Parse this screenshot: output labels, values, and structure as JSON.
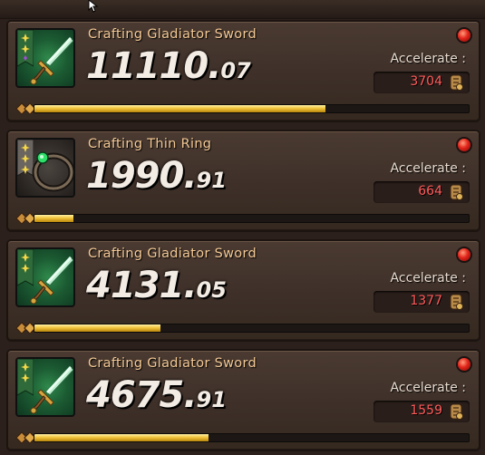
{
  "colors": {
    "title_text": "#f3c995",
    "timer_text": "#f3ece4",
    "accelerate_value": "#ff5b5b",
    "progress_fill": "#f2c43c",
    "alert_dot": "#e2241a",
    "panel_bg": "#3e3029"
  },
  "cursor_icon": "mouse-pointer-icon",
  "queue": [
    {
      "title": "Crafting Gladiator Sword",
      "timer_main": "11110.",
      "timer_frac": "07",
      "accelerate_label": "Accelerate :",
      "accelerate_value": "3704",
      "progress": 0.67,
      "item": "gladiator-sword",
      "rank_stars": 3,
      "rarity_gem": "purple",
      "slot_color": "green"
    },
    {
      "title": "Crafting Thin Ring",
      "timer_main": "1990.",
      "timer_frac": "91",
      "accelerate_label": "Accelerate :",
      "accelerate_value": "664",
      "progress": 0.09,
      "item": "thin-ring",
      "rank_stars": 3,
      "rarity_gem": "",
      "slot_color": "gray"
    },
    {
      "title": "Crafting Gladiator Sword",
      "timer_main": "4131.",
      "timer_frac": "05",
      "accelerate_label": "Accelerate :",
      "accelerate_value": "1377",
      "progress": 0.29,
      "item": "gladiator-sword",
      "rank_stars": 2,
      "rarity_gem": "",
      "slot_color": "green"
    },
    {
      "title": "Crafting Gladiator Sword",
      "timer_main": "4675.",
      "timer_frac": "91",
      "accelerate_label": "Accelerate :",
      "accelerate_value": "1559",
      "progress": 0.4,
      "item": "gladiator-sword",
      "rank_stars": 2,
      "rarity_gem": "",
      "slot_color": "green"
    }
  ]
}
